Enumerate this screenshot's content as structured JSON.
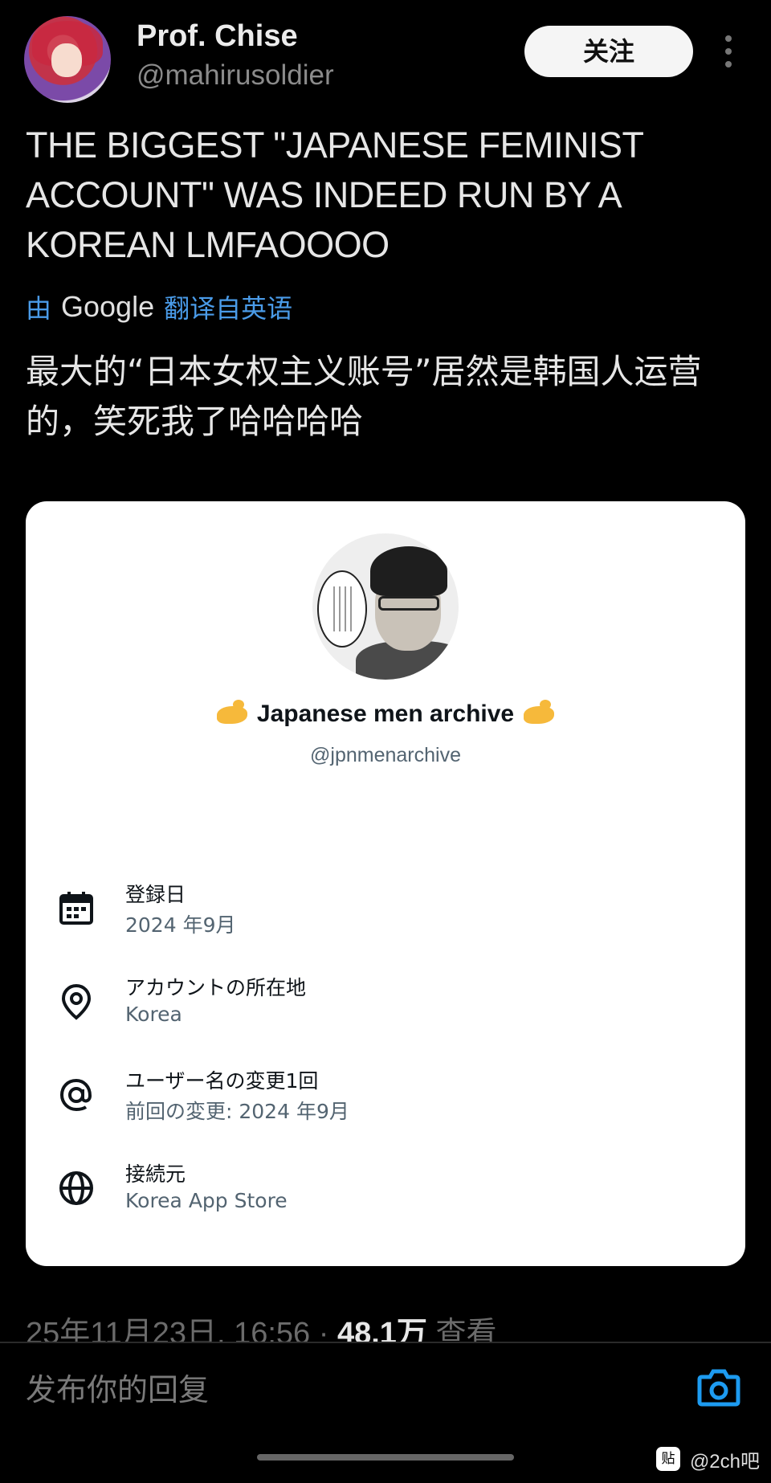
{
  "tweet": {
    "author_name": "Prof. Chise",
    "author_handle": "@mahirusoldier",
    "follow_label": "关注",
    "text": "THE BIGGEST \"JAPANESE FEMINIST ACCOUNT\" WAS INDEED RUN BY A KOREAN LMFAOOOO",
    "translate_prefix": "由",
    "translate_brand": "Google",
    "translate_suffix": "翻译自英语",
    "translated_text": "最大的“日本女权主义账号”居然是韩国人运营的，笑死我了哈哈哈哈"
  },
  "card": {
    "account_name": "Japanese men archive",
    "account_handle": "@jpnmenarchive",
    "rows": [
      {
        "icon": "calendar-icon",
        "title": "登録日",
        "sub": "2024 年9月"
      },
      {
        "icon": "location-pin-icon",
        "title": "アカウントの所在地",
        "sub": "Korea"
      },
      {
        "icon": "at-sign-icon",
        "title": "ユーザー名の変更1回",
        "sub": "前回の変更: 2024 年9月"
      },
      {
        "icon": "globe-icon",
        "title": "接続元",
        "sub": "Korea App Store"
      }
    ]
  },
  "meta": {
    "timestamp": "25年11月23日, 16:56 ·",
    "views_count": "48.1万",
    "views_label": "查看"
  },
  "reply": {
    "placeholder": "发布你的回复"
  },
  "watermark": {
    "badge": "贴",
    "text": "@2ch吧"
  },
  "colors": {
    "background": "#000000",
    "translate_link": "#4a9be8",
    "camera_accent": "#1d9bf0",
    "card_bg": "#ffffff"
  }
}
